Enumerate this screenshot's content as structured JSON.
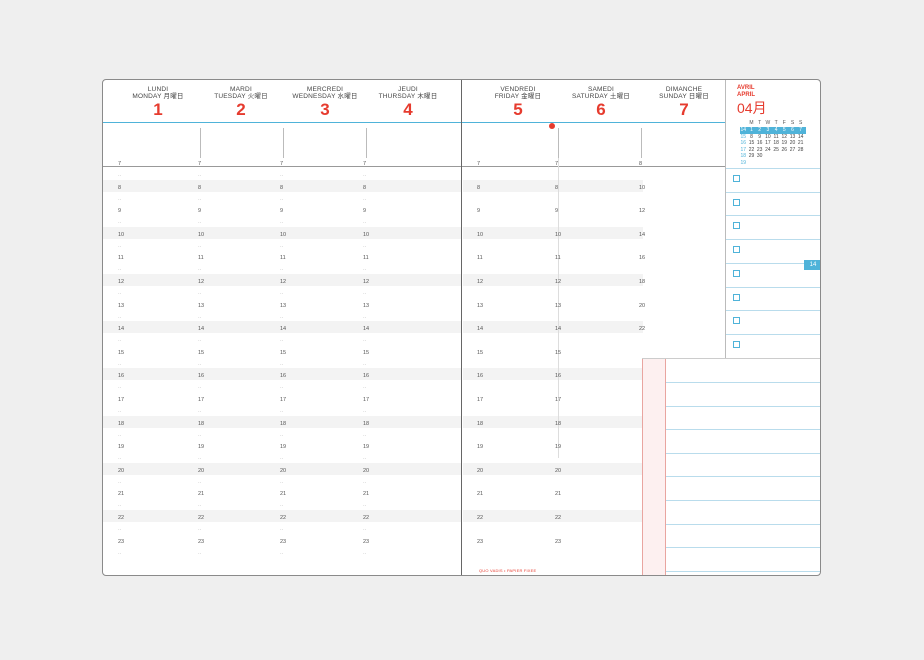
{
  "days_left": [
    {
      "fr": "LUNDI",
      "en": "MONDAY 月曜日",
      "num": "1"
    },
    {
      "fr": "MARDI",
      "en": "TUESDAY 火曜日",
      "num": "2"
    },
    {
      "fr": "MERCREDI",
      "en": "WEDNESDAY 水曜日",
      "num": "3"
    },
    {
      "fr": "JEUDI",
      "en": "THURSDAY 木曜日",
      "num": "4"
    }
  ],
  "days_right": [
    {
      "fr": "VENDREDI",
      "en": "FRIDAY 金曜日",
      "num": "5"
    },
    {
      "fr": "SAMEDI",
      "en": "SATURDAY 土曜日",
      "num": "6"
    },
    {
      "fr": "DIMANCHE",
      "en": "SUNDAY 日曜日",
      "num": "7"
    }
  ],
  "hours": [
    "7",
    "8",
    "9",
    "10",
    "11",
    "12",
    "13",
    "14",
    "15",
    "16",
    "17",
    "18",
    "19",
    "20",
    "21",
    "22",
    "23"
  ],
  "sunday_hours": [
    "8",
    "10",
    "12",
    "14",
    "16",
    "18",
    "20",
    "22"
  ],
  "month": {
    "fr": "AVRIL",
    "en": "APRIL",
    "jp": "04月"
  },
  "mini_cal": {
    "headers": [
      "M",
      "T",
      "W",
      "T",
      "F",
      "S",
      "S"
    ],
    "week_nums": [
      "14",
      "15",
      "16",
      "17",
      "18",
      "19"
    ],
    "rows": [
      [
        "1",
        "2",
        "3",
        "4",
        "5",
        "6",
        "7"
      ],
      [
        "8",
        "9",
        "10",
        "11",
        "12",
        "13",
        "14"
      ],
      [
        "15",
        "16",
        "17",
        "18",
        "19",
        "20",
        "21"
      ],
      [
        "22",
        "23",
        "24",
        "25",
        "26",
        "27",
        "28"
      ],
      [
        "29",
        "30",
        "",
        "",
        "",
        "",
        ""
      ]
    ]
  },
  "week_tab": "14",
  "footer_note": "QUO VADIS • PAPIER FIXEE"
}
